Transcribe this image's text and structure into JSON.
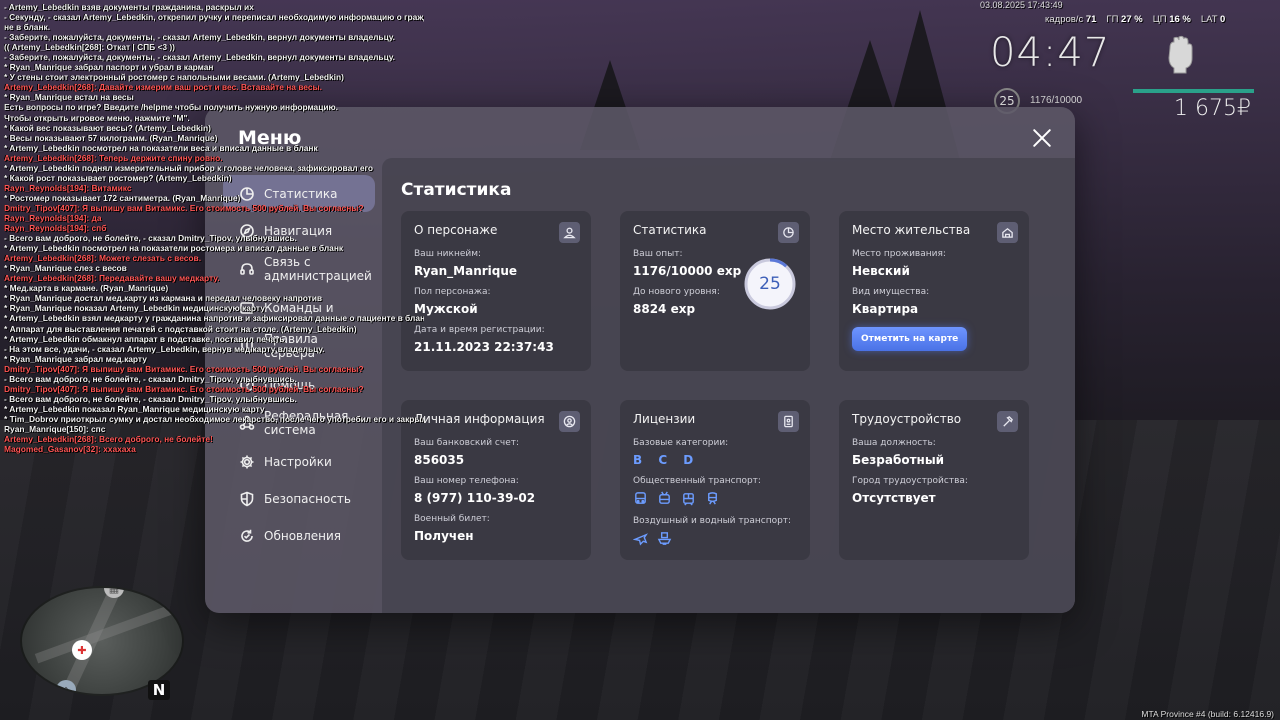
{
  "chat": [
    {
      "c": "w",
      "t": "- Artemy_Lebedkin взяв документы гражданина, раскрыл их"
    },
    {
      "c": "w",
      "t": "- Секунду, - сказал Artemy_Lebedkin, открепил ручку и переписал необходимую информацию о граждани"
    },
    {
      "c": "w",
      "t": "не в бланк."
    },
    {
      "c": "w",
      "t": "- Заберите, пожалуйста, документы, - сказал Artemy_Lebedkin, вернул документы владельцу."
    },
    {
      "c": "w",
      "t": "(( Artemy_Lebedkin[268]: Откат | СПБ <3 ))"
    },
    {
      "c": "w",
      "t": "- Заберите, пожалуйста, документы, - сказал Artemy_Lebedkin, вернул документы владельцу."
    },
    {
      "c": "w",
      "t": "* Ryan_Manrique забрал паспорт и убрал в карман"
    },
    {
      "c": "w",
      "t": "* У стены стоит электронный ростомер с напольными весами. (Artemy_Lebedkin)"
    },
    {
      "c": "r",
      "t": "Artemy_Lebedkin[268]: Давайте измерим ваш рост и вес. Вставайте на весы."
    },
    {
      "c": "w",
      "t": "* Ryan_Manrique встал на весы"
    },
    {
      "c": "w",
      "t": "Есть вопросы по игре? Введите /helpme чтобы получить нужную информацию."
    },
    {
      "c": "w",
      "t": "Чтобы открыть игровое меню, нажмите \"M\"."
    },
    {
      "c": "w",
      "t": "* Какой вес показывают весы? (Artemy_Lebedkin)"
    },
    {
      "c": "w",
      "t": "* Весы показывают 57 килограмм. (Ryan_Manrique)"
    },
    {
      "c": "w",
      "t": "* Artemy_Lebedkin посмотрел на показатели веса и вписал данные в бланк"
    },
    {
      "c": "r",
      "t": "Artemy_Lebedkin[268]: Теперь держите спину ровно."
    },
    {
      "c": "w",
      "t": "* Artemy_Lebedkin поднял измерительный прибор к голове человека, зафиксировал его"
    },
    {
      "c": "w",
      "t": "* Какой рост показывает ростомер? (Artemy_Lebedkin)"
    },
    {
      "c": "r",
      "t": "Rayn_Reynolds[194]: Витамикс"
    },
    {
      "c": "w",
      "t": "* Ростомер показывает 172 сантиметра. (Ryan_Manrique)"
    },
    {
      "c": "r",
      "t": "Dmitry_Tipov[407]: Я выпишу вам Витамикс. Его стоимость 500 рублей. Вы согласны?"
    },
    {
      "c": "r",
      "t": "Rayn_Reynolds[194]: да"
    },
    {
      "c": "r",
      "t": "Rayn_Reynolds[194]: спб"
    },
    {
      "c": "w",
      "t": "- Всего вам доброго, не болейте, - сказал Dmitry_Tipov, улыбнувшись."
    },
    {
      "c": "w",
      "t": "* Artemy_Lebedkin посмотрел на показатели ростомера и вписал данные в бланк"
    },
    {
      "c": "r",
      "t": "Artemy_Lebedkin[268]: Можете слезать с весов."
    },
    {
      "c": "w",
      "t": "* Ryan_Manrique слез с весов"
    },
    {
      "c": "r",
      "t": "Artemy_Lebedkin[268]: Передавайте вашу медкарту."
    },
    {
      "c": "w",
      "t": "* Мед.карта в кармане. (Ryan_Manrique)"
    },
    {
      "c": "w",
      "t": "* Ryan_Manrique достал мед.карту из кармана и передал человеку напротив"
    },
    {
      "c": "w",
      "t": "* Ryan_Manrique показал Artemy_Lebedkin медицинскую карту"
    },
    {
      "c": "w",
      "t": "* Artemy_Lebedkin взял медкарту у гражданина напротив и зафиксировал данные о пациенте в бланк"
    },
    {
      "c": "w",
      "t": "* Аппарат для выставления печатей с подставкой стоит на столе. (Artemy_Lebedkin)"
    },
    {
      "c": "w",
      "t": "* Artemy_Lebedkin обмакнул аппарат в подставке, поставил печать"
    },
    {
      "c": "w",
      "t": "- На этом все, удачи, - сказал Artemy_Lebedkin, вернув мед.карту владельцу."
    },
    {
      "c": "w",
      "t": "* Ryan_Manrique забрал мед.карту"
    },
    {
      "c": "r",
      "t": "Dmitry_Tipov[407]: Я выпишу вам Витамикс. Его стоимость 500 рублей. Вы согласны?"
    },
    {
      "c": "w",
      "t": "- Всего вам доброго, не болейте, - сказал Dmitry_Tipov, улыбнувшись."
    },
    {
      "c": "r",
      "t": "Dmitry_Tipov[407]: Я выпишу вам Витамикс. Его стоимость 500 рублей. Вы согласны?"
    },
    {
      "c": "w",
      "t": "- Всего вам доброго, не болейте, - сказал Dmitry_Tipov, улыбнувшись."
    },
    {
      "c": "w",
      "t": "* Artemy_Lebedkin показал Ryan_Manrique медицинскую карту"
    },
    {
      "c": "w",
      "t": "* Tim_Dobrov приоткрыл сумку и достал необходимое лекарство, после чего употребил его и закрыл сумку"
    },
    {
      "c": "w",
      "t": "Ryan_Manrique[150]: спс"
    },
    {
      "c": "r",
      "t": "Artemy_Lebedkin[268]: Всего доброго, не болейте!"
    },
    {
      "c": "r",
      "t": "Magomed_Gasanov[32]: ххахаха"
    }
  ],
  "hud": {
    "date": "03.08.2025 17:43:49",
    "frames_label": "кадров/с",
    "frames": "71",
    "gp_label": "ГП",
    "gp": "27 %",
    "cp_label": "ЦП",
    "cp": "16 %",
    "lat_label": "LAT",
    "lat": "0",
    "time": "04:47",
    "level": "25",
    "exp": "1176/10000",
    "money": "1 675₽",
    "build": "MTA Province #4 (build: 6.12416.9)",
    "compass": "N"
  },
  "menu": {
    "title": "Меню",
    "nav": [
      {
        "id": "stats",
        "label": "Статистика",
        "icon": "pie-chart-icon",
        "active": true
      },
      {
        "id": "navigation",
        "label": "Навигация",
        "icon": "compass-icon"
      },
      {
        "id": "admin",
        "label": "Связь с администрацией",
        "icon": "headset-icon"
      },
      {
        "id": "commands",
        "label": "Команды и",
        "icon": "terminal-icon"
      },
      {
        "id": "rules",
        "label": "Правила сервера",
        "icon": "book-icon"
      },
      {
        "id": "help",
        "label": "Помощь",
        "icon": "help-icon"
      },
      {
        "id": "referral",
        "label": "Реферальная система",
        "icon": "network-icon"
      },
      {
        "id": "settings",
        "label": "Настройки",
        "icon": "gear-icon"
      },
      {
        "id": "security",
        "label": "Безопасность",
        "icon": "shield-icon"
      },
      {
        "id": "updates",
        "label": "Обновления",
        "icon": "refresh-icon"
      }
    ]
  },
  "stats": {
    "title": "Статистика",
    "character": {
      "title": "О персонаже",
      "nick_label": "Ваш никнейм:",
      "nick": "Ryan_Manrique",
      "gender_label": "Пол персонажа:",
      "gender": "Мужской",
      "reg_label": "Дата и время регистрации:",
      "reg": "21.11.2023 22:37:43"
    },
    "statistics": {
      "title": "Статистика",
      "exp_label": "Ваш опыт:",
      "exp": "1176/10000 exp",
      "next_label": "До нового уровня:",
      "next": "8824 exp",
      "level": "25",
      "progress": 0.1176
    },
    "residence": {
      "title": "Место жительства",
      "place_label": "Место проживания:",
      "place": "Невский",
      "property_label": "Вид имущества:",
      "property": "Квартира",
      "map_button": "Отметить на карте"
    },
    "personal": {
      "title": "Личная информация",
      "bank_label": "Ваш банковский счет:",
      "bank": "856035",
      "phone_label": "Ваш номер телефона:",
      "phone": "8 (977) 110-39-02",
      "military_label": "Военный билет:",
      "military": "Получен"
    },
    "licenses": {
      "title": "Лицензии",
      "base_label": "Базовые категории:",
      "base": "B C D",
      "public_label": "Общественный транспорт:",
      "air_label": "Воздушный и водный транспорт:"
    },
    "employment": {
      "title": "Трудоустройство",
      "position_label": "Ваша должность:",
      "position": "Безработный",
      "city_label": "Город трудоустройства:",
      "city": "Отсутствует"
    }
  },
  "colors": {
    "accent": "#6c9cff",
    "hp": "#2aa18a",
    "chat_red": "#ff5555"
  }
}
